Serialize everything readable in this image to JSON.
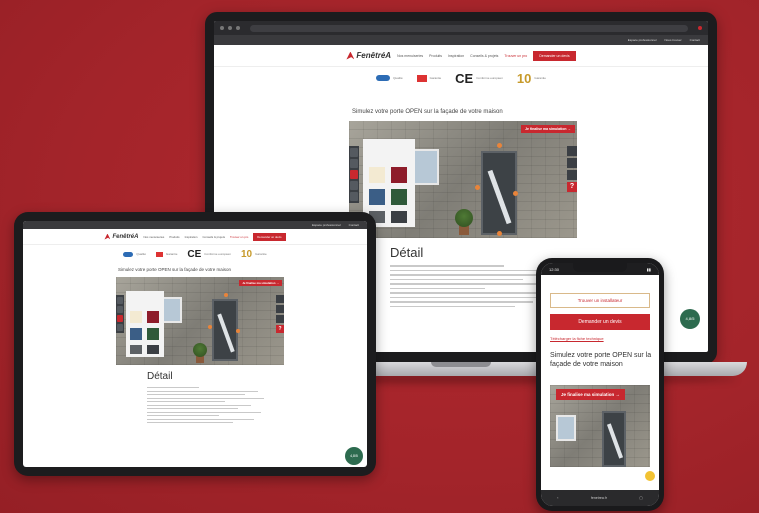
{
  "brand": {
    "name": "FenêtréA",
    "accent": "#c8282f",
    "background": "#a8262b"
  },
  "desktop_nav": {
    "items": [
      "Nos menuiseries",
      "Produits",
      "Inspiration",
      "Conseils & projets",
      "Trouver un pro"
    ],
    "cta": "Demander un devis",
    "top_links": [
      "Espace professionnel",
      "Nous trouver",
      "Contact"
    ]
  },
  "badges": {
    "badge1": "Qualité",
    "badge2": "Garantie",
    "ce_mark": "CE",
    "ce_text": "Conforme européen",
    "ten": "10",
    "ten_text": "Garantie"
  },
  "simulator": {
    "title": "Simulez votre porte OPEN sur la façade de votre maison",
    "finish_button": "Je finalise ma simulation →",
    "help": "?"
  },
  "detail": {
    "heading": "Détail"
  },
  "phone": {
    "time": "12:30",
    "find_installer": "Trouver un installateur",
    "request_quote": "Demander un devis",
    "tech_sheet_link": "Télécharger la fiche technique",
    "title": "Simulez votre porte OPEN sur la façade de votre maison",
    "finish_button": "Je finalise ma simulation →",
    "bottom_bar": "fenetrea.fr"
  },
  "rating": {
    "value": "4,8/5"
  },
  "palette_colors": [
    "#f3ead2",
    "#8e1c2a",
    "#3b5e86",
    "#2f5a3a",
    "#5d6165",
    "#3b3f44"
  ]
}
